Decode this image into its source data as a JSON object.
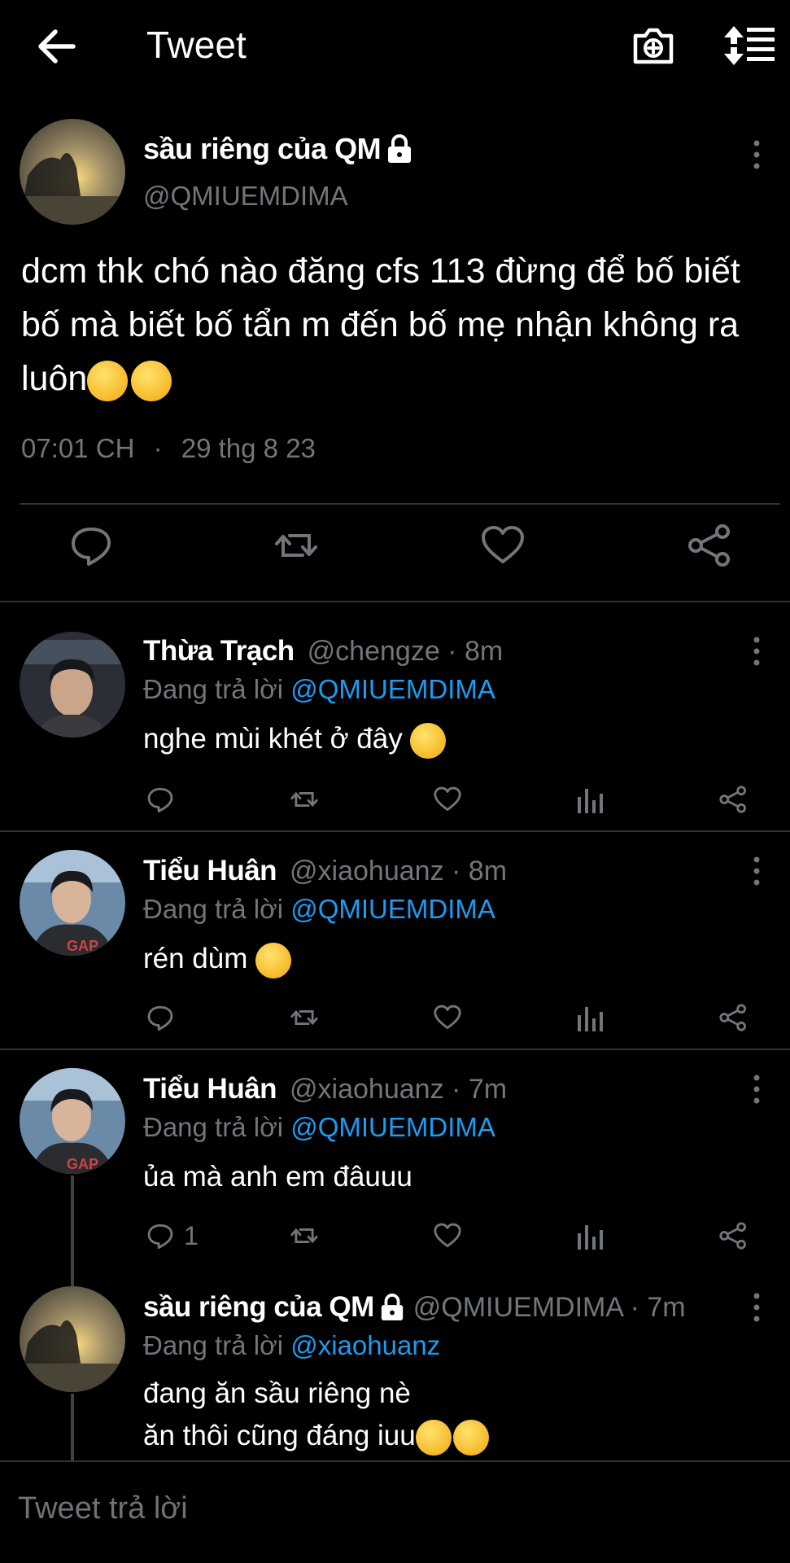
{
  "header": {
    "title": "Tweet",
    "icons": [
      "back-arrow-icon",
      "camera-plus-icon",
      "sort-replies-icon"
    ]
  },
  "main_tweet": {
    "name": "sầu riêng của QM",
    "handle": "@QMIUEMDIMA",
    "text": "dcm thk chó nào đăng cfs 113 đừng để bố biết bố mà biết bố tẩn m đến bố mẹ nhận không ra luôn",
    "time": "07:01 CH",
    "dot": "·",
    "date": "29 thg 8 23",
    "actions": [
      "reply-icon",
      "retweet-icon",
      "like-icon",
      "share-icon"
    ]
  },
  "replies": [
    {
      "name": "Thừa Trạch",
      "handle": "@chengze · 8m",
      "replying_label": "Đang trả lời",
      "replying_to": "@QMIUEMDIMA",
      "text": "nghe mùi khét ở đây",
      "reply_count": ""
    },
    {
      "name": "Tiểu Huân",
      "handle": "@xiaohuanz · 8m",
      "replying_label": "Đang trả lời",
      "replying_to": "@QMIUEMDIMA",
      "text": "rén dùm",
      "reply_count": ""
    },
    {
      "name": "Tiểu Huân",
      "handle": "@xiaohuanz · 7m",
      "replying_label": "Đang trả lời",
      "replying_to": "@QMIUEMDIMA",
      "text": "ủa mà anh em đâuuu",
      "reply_count": "1"
    },
    {
      "name": "sầu riêng của QM",
      "handle": "@QMIUEMDIMA · 7m",
      "replying_label": "Đang trả lời",
      "replying_to": "@xiaohuanz",
      "text_line1": "đang ăn sầu riêng nè",
      "text_line2": "ăn thôi cũng đáng iuu"
    }
  ],
  "compose": {
    "placeholder": "Tweet trả lời"
  },
  "colors": {
    "background": "#000000",
    "secondary_text": "#71767b",
    "mention": "#1d9bf0",
    "divider": "#2f3336"
  }
}
